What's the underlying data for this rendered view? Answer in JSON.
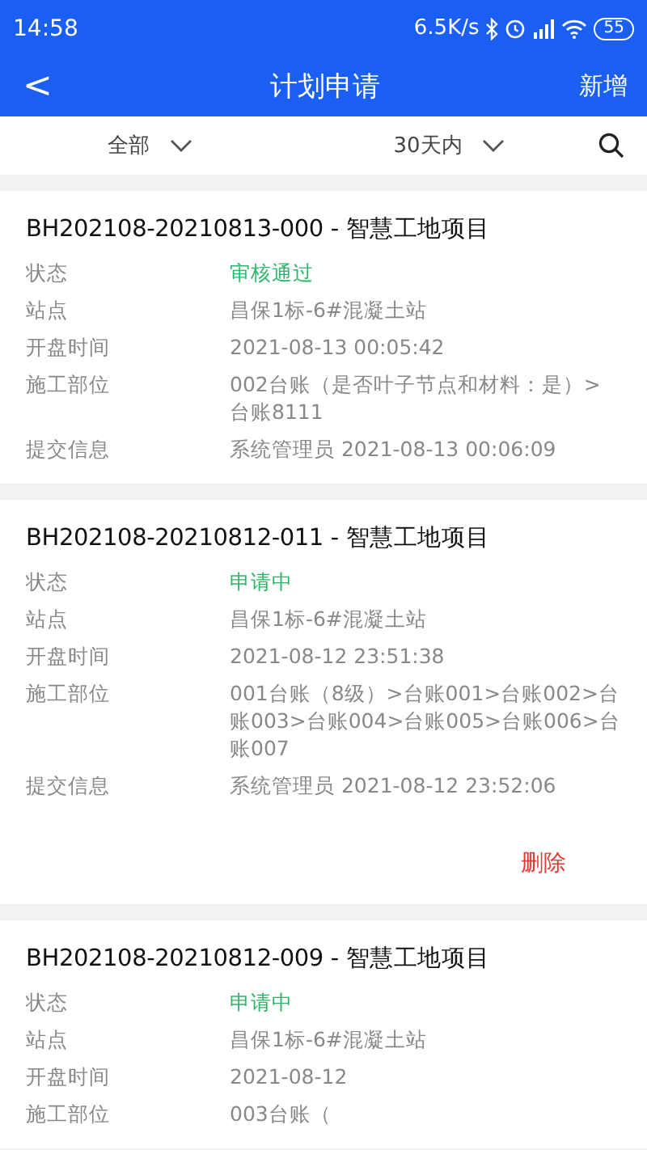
{
  "status_bar": {
    "time": "14:58",
    "speed": "6.5K/s",
    "battery": "55"
  },
  "nav": {
    "back": "<",
    "title": "计划申请",
    "action": "新增"
  },
  "filters": [
    {
      "label": "全部"
    },
    {
      "label": "30天内"
    }
  ],
  "cards": [
    {
      "title": "BH202108-20210813-000 - 智慧工地项目",
      "fields": [
        {
          "label": "状态",
          "value": "审核通过",
          "color": "#2db56a"
        },
        {
          "label": "站点",
          "value": "昌保1标-6#混凝土站"
        },
        {
          "label": "开盘时间",
          "value": "2021-08-13 00:05:42"
        },
        {
          "label": "施工部位",
          "value": "002台账（是否叶子节点和材料：是）>台账8111"
        },
        {
          "label": "提交信息",
          "value": "系统管理员 2021-08-13 00:06:09"
        }
      ]
    },
    {
      "title": "BH202108-20210812-011 - 智慧工地项目",
      "fields": [
        {
          "label": "状态",
          "value": "申请中",
          "color": "#2db56a"
        },
        {
          "label": "站点",
          "value": "昌保1标-6#混凝土站"
        },
        {
          "label": "开盘时间",
          "value": "2021-08-12 23:51:38"
        },
        {
          "label": "施工部位",
          "value": "001台账（8级）>台账001>台账002>台账003>台账004>台账005>台账006>台账007"
        },
        {
          "label": "提交信息",
          "value": "系统管理员 2021-08-12 23:52:06"
        }
      ],
      "delete": "删除"
    },
    {
      "title": "BH202108-20210812-009 - 智慧工地项目",
      "fields": [
        {
          "label": "状态",
          "value": "申请中",
          "color": "#2db56a"
        },
        {
          "label": "站点",
          "value": "昌保1标-6#混凝土站"
        },
        {
          "label": "开盘时间",
          "value": "2021-08-12"
        },
        {
          "label": "施工部位",
          "value": "003台账（"
        }
      ]
    }
  ]
}
